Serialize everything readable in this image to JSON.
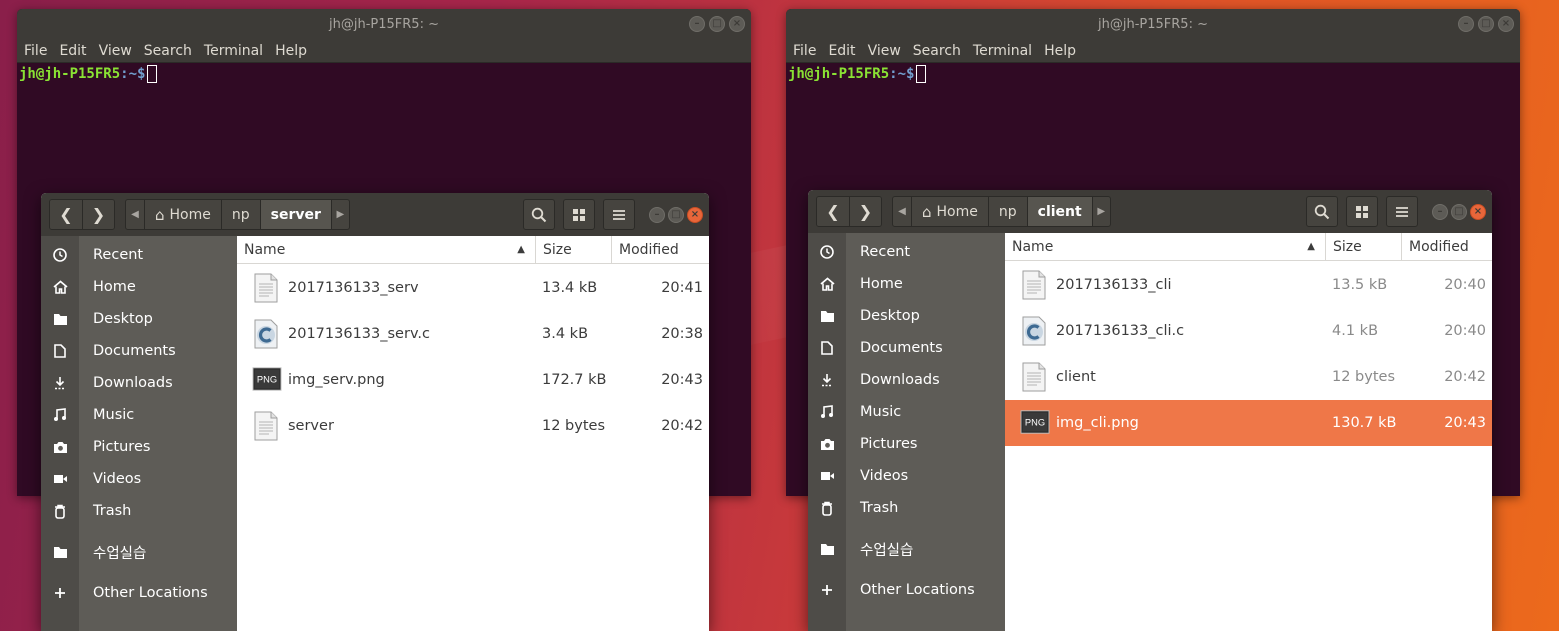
{
  "terminal_menu": [
    "File",
    "Edit",
    "View",
    "Search",
    "Terminal",
    "Help"
  ],
  "terminals": [
    {
      "title": "jh@jh-P15FR5: ~",
      "prompt_user": "jh@jh-P15FR5",
      "prompt_path": ":~$"
    },
    {
      "title": "jh@jh-P15FR5: ~",
      "prompt_user": "jh@jh-P15FR5",
      "prompt_path": ":~$"
    }
  ],
  "file_managers": [
    {
      "breadcrumbs": [
        "Home",
        "np",
        "server"
      ],
      "columns": {
        "name": "Name",
        "size": "Size",
        "modified": "Modified"
      },
      "sidebar": [
        "Recent",
        "Home",
        "Desktop",
        "Documents",
        "Downloads",
        "Music",
        "Pictures",
        "Videos",
        "Trash",
        "수업실습",
        "Other Locations"
      ],
      "files": [
        {
          "name": "2017136133_serv",
          "size": "13.4 kB",
          "modified": "20:41",
          "icon": "text-file-icon"
        },
        {
          "name": "2017136133_serv.c",
          "size": "3.4 kB",
          "modified": "20:38",
          "icon": "c-source-icon"
        },
        {
          "name": "img_serv.png",
          "size": "172.7 kB",
          "modified": "20:43",
          "icon": "png-file-icon"
        },
        {
          "name": "server",
          "size": "12 bytes",
          "modified": "20:42",
          "icon": "text-file-icon"
        }
      ]
    },
    {
      "breadcrumbs": [
        "Home",
        "np",
        "client"
      ],
      "columns": {
        "name": "Name",
        "size": "Size",
        "modified": "Modified"
      },
      "sidebar": [
        "Recent",
        "Home",
        "Desktop",
        "Documents",
        "Downloads",
        "Music",
        "Pictures",
        "Videos",
        "Trash",
        "수업실습",
        "Other Locations"
      ],
      "files": [
        {
          "name": "2017136133_cli",
          "size": "13.5 kB",
          "modified": "20:40",
          "icon": "text-file-icon"
        },
        {
          "name": "2017136133_cli.c",
          "size": "4.1 kB",
          "modified": "20:40",
          "icon": "c-source-icon"
        },
        {
          "name": "client",
          "size": "12 bytes",
          "modified": "20:42",
          "icon": "text-file-icon"
        },
        {
          "name": "img_cli.png",
          "size": "130.7 kB",
          "modified": "20:43",
          "icon": "png-file-icon",
          "selected": true
        }
      ]
    }
  ],
  "colors": {
    "terminal_bg": "#300a24",
    "titlebar": "#3d3b37",
    "selection": "#ef7748",
    "prompt_user": "#8ae234",
    "prompt_path": "#729fcf"
  }
}
